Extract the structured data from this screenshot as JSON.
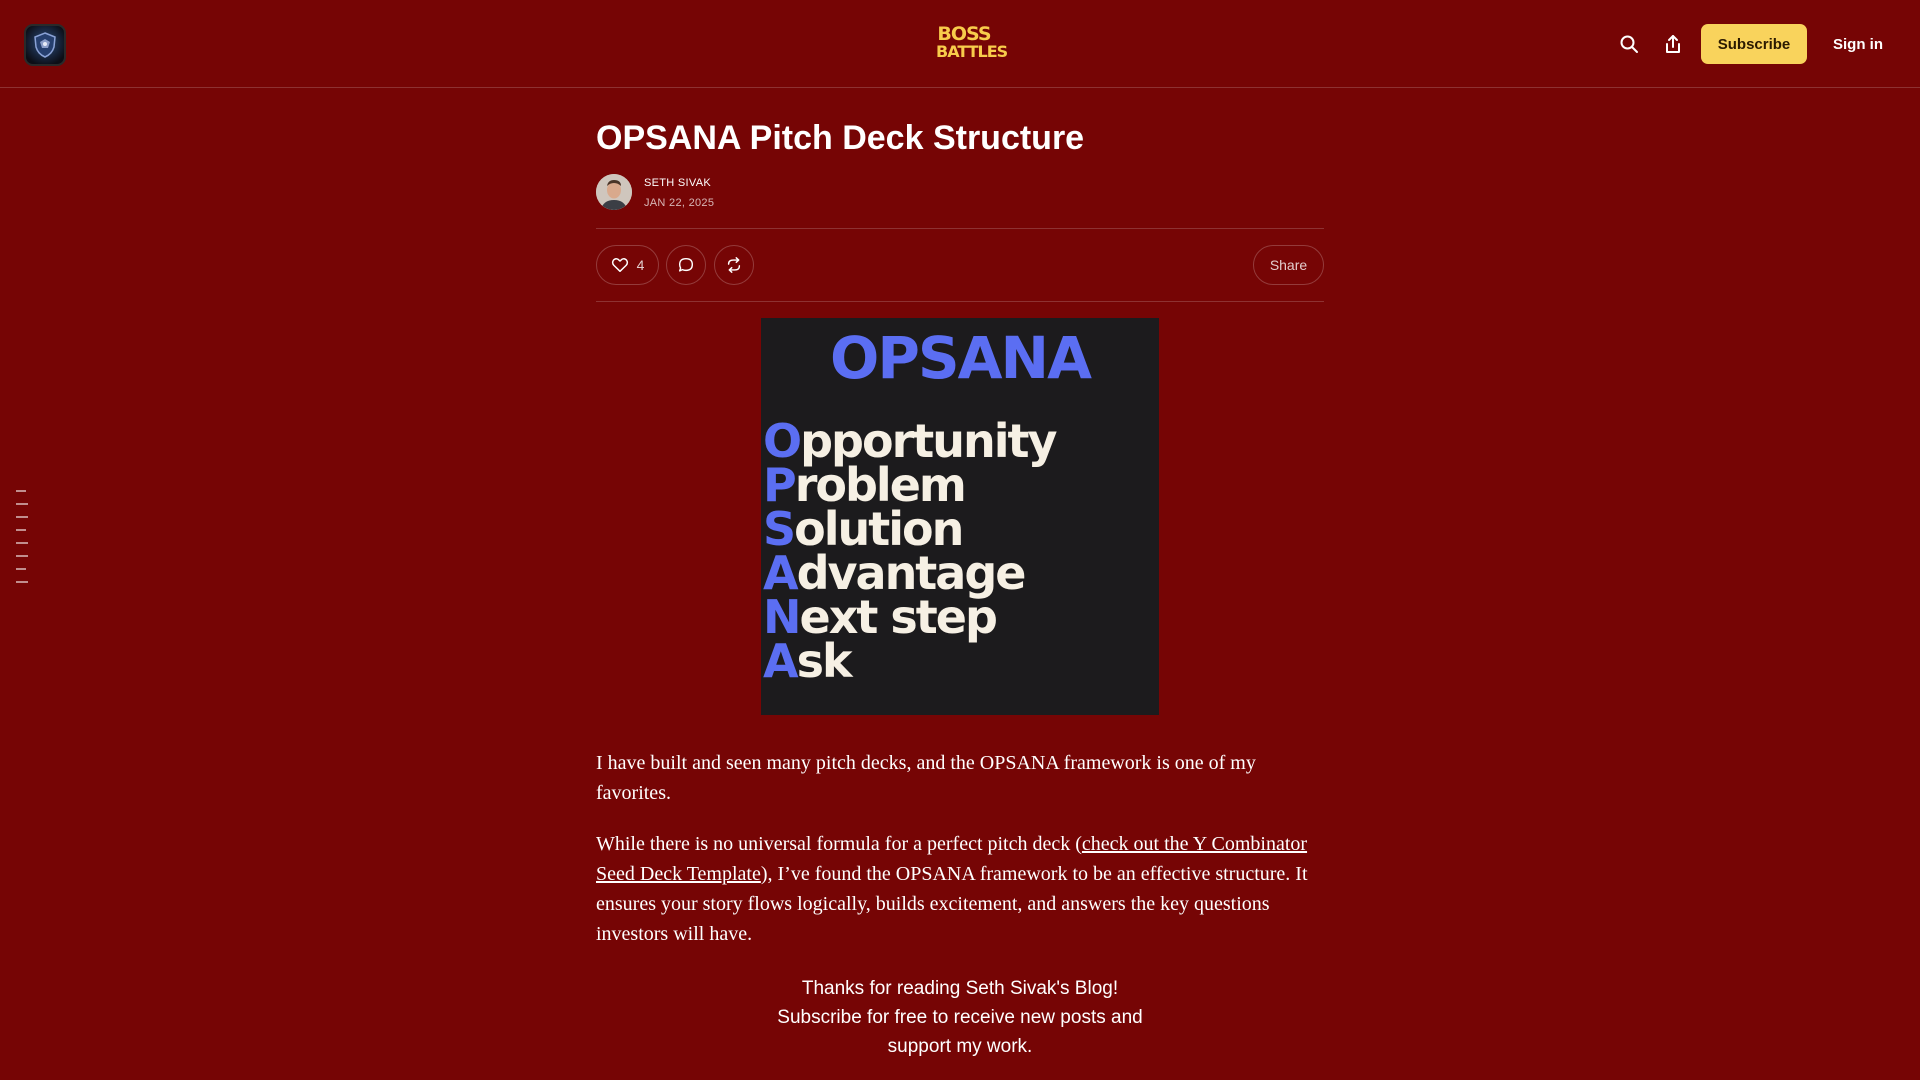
{
  "header": {
    "logo_icon": "publication-logo-icon",
    "wordmark_line1": "BOSS",
    "wordmark_line2": "BATTLES",
    "search_icon": "search-icon",
    "share_icon": "share-upload-icon",
    "subscribe_label": "Subscribe",
    "signin_label": "Sign in",
    "accent_color": "#f9d35c"
  },
  "toc": {
    "marks": 8
  },
  "post": {
    "title": "OPSANA Pitch Deck Structure",
    "author": "SETH SIVAK",
    "date": "JAN 22, 2025",
    "like_count": "4",
    "share_label": "Share",
    "icons": [
      "heart-icon",
      "comment-icon",
      "restack-icon"
    ]
  },
  "hero_image": {
    "title": "OPSANA",
    "rows": [
      {
        "initial": "O",
        "rest": "pportunity"
      },
      {
        "initial": "P",
        "rest": "roblem"
      },
      {
        "initial": "S",
        "rest": "olution"
      },
      {
        "initial": "A",
        "rest": "dvantage"
      },
      {
        "initial": "N",
        "rest": "ext step"
      },
      {
        "initial": "A",
        "rest": "sk"
      }
    ],
    "accent_color": "#5b6ef2",
    "background_color": "#1c1b1d"
  },
  "body": {
    "p1": "I have built and seen many pitch decks, and the OPSANA framework is one of my favorites.",
    "p2_before": "While there is no universal formula for a perfect pitch deck (",
    "p2_link": "check out the Y Combinator Seed Deck Template",
    "p2_after": "), I’ve found the OPSANA framework to be an effective structure. It ensures your story flows logically, builds excitement, and answers the key questions investors will have.",
    "cta_line1": "Thanks for reading Seth Sivak's Blog!",
    "cta_line2": "Subscribe for free to receive new posts and",
    "cta_line3": "support my work."
  },
  "colors": {
    "background": "#760505"
  }
}
